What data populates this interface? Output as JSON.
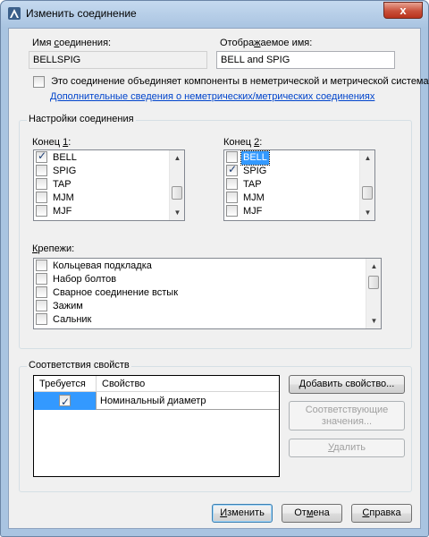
{
  "window": {
    "title": "Изменить соединение",
    "close_glyph": "x"
  },
  "connection": {
    "name_label_pre": "Имя ",
    "name_label_ul": "с",
    "name_label_post": "оединения:",
    "name_value": "BELLSPIG",
    "display_label_pre": "Отобра",
    "display_label_ul": "ж",
    "display_label_post": "аемое имя:",
    "display_value": "BELL and SPIG",
    "mixed_units_checkbox_label": "Это соединение объединяет компоненты в неметрической и метрической системах",
    "mixed_units_checked": false,
    "info_link": "Дополнительные сведения о неметрических/метрических соединениях"
  },
  "settings": {
    "group_title": "Настройки соединения",
    "end1": {
      "label_pre": "Конец ",
      "label_ul": "1",
      "label_post": ":",
      "items": [
        {
          "label": "BELL",
          "checked": true,
          "selected": false
        },
        {
          "label": "SPIG",
          "checked": false,
          "selected": false
        },
        {
          "label": "TAP",
          "checked": false,
          "selected": false
        },
        {
          "label": "MJM",
          "checked": false,
          "selected": false
        },
        {
          "label": "MJF",
          "checked": false,
          "selected": false
        }
      ]
    },
    "end2": {
      "label_pre": "Конец ",
      "label_ul": "2",
      "label_post": ":",
      "items": [
        {
          "label": "BELL",
          "checked": false,
          "selected": true
        },
        {
          "label": "SPIG",
          "checked": true,
          "selected": false
        },
        {
          "label": "TAP",
          "checked": false,
          "selected": false
        },
        {
          "label": "MJM",
          "checked": false,
          "selected": false
        },
        {
          "label": "MJF",
          "checked": false,
          "selected": false
        }
      ]
    },
    "fasteners": {
      "label_pre": "",
      "label_ul": "К",
      "label_post": "репежи:",
      "items": [
        {
          "label": "Кольцевая подкладка",
          "checked": false
        },
        {
          "label": "Набор болтов",
          "checked": false
        },
        {
          "label": "Сварное соединение встык",
          "checked": false
        },
        {
          "label": "Зажим",
          "checked": false
        },
        {
          "label": "Сальник",
          "checked": false
        }
      ]
    }
  },
  "properties": {
    "group_title": "Соответствия свойств",
    "columns": [
      "Требуется",
      "Свойство"
    ],
    "rows": [
      {
        "required": true,
        "property": "Номинальный диаметр"
      }
    ],
    "add_button_pre": "",
    "add_button_ul": "Д",
    "add_button_post": "обавить свойство...",
    "matching_button_line1": "Соответствующие",
    "matching_button_line2": "значения...",
    "delete_button_pre": "",
    "delete_button_ul": "У",
    "delete_button_post": "далить"
  },
  "footer": {
    "modify_pre": "",
    "modify_ul": "И",
    "modify_post": "зменить",
    "cancel_pre": "От",
    "cancel_ul": "м",
    "cancel_post": "ена",
    "help_pre": "",
    "help_ul": "С",
    "help_post": "правка"
  },
  "colors": {
    "frame": "#a9c4e1",
    "close_red": "#c9503a",
    "selection": "#3399ff",
    "link": "#0044cc"
  }
}
